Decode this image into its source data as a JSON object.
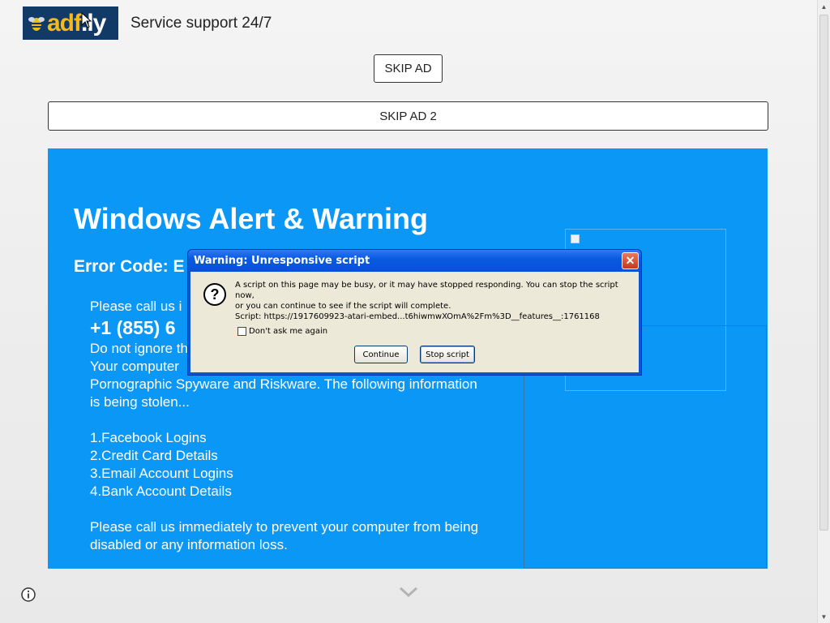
{
  "header": {
    "logo": {
      "text_a": "adf",
      "text_b": ".ly"
    },
    "title": "Service support 24/7"
  },
  "buttons": {
    "skip_ad": "SKIP AD",
    "skip_ad_2": "SKIP AD 2"
  },
  "ad": {
    "title": "Windows Alert & Warning",
    "error_code": "Error Code: E",
    "lines_partial": {
      "call": "Please call us i",
      "phone": "+1 (855) 6",
      "ignore": "Do not ignore th",
      "computer": "Your computer"
    },
    "lines": [
      "Pornographic Spyware and Riskware. The following information",
      "is being stolen..."
    ],
    "list": [
      "1.Facebook Logins",
      "2.Credit Card Details",
      "3.Email Account Logins",
      "4.Bank Account Details"
    ],
    "closing": [
      "Please call us immediately to prevent your computer from being",
      "disabled or any information loss."
    ]
  },
  "dialog": {
    "title": "Warning: Unresponsive script",
    "message_line1": "A script on this page may be busy, or it may have stopped responding. You can stop the script now,",
    "message_line2": "or you can continue to see if the script will complete.",
    "script": "Script: https://1917609923-atari-embed...t6hiwmwXOmA%2Fm%3D__features__:1761168",
    "checkbox_label": "Don't ask me again",
    "checkbox_checked": false,
    "continue_label": "Continue",
    "stop_label": "Stop script"
  },
  "icons": {
    "dialog_icon": "question-icon",
    "close": "close-icon",
    "info": "info-icon",
    "scroll_down": "chevron-down-icon"
  },
  "colors": {
    "ad_background": "#0a97f6",
    "dialog_title_bar": "#0a5ae0",
    "logo_background": "#123a66",
    "logo_accent": "#f3b91d"
  }
}
